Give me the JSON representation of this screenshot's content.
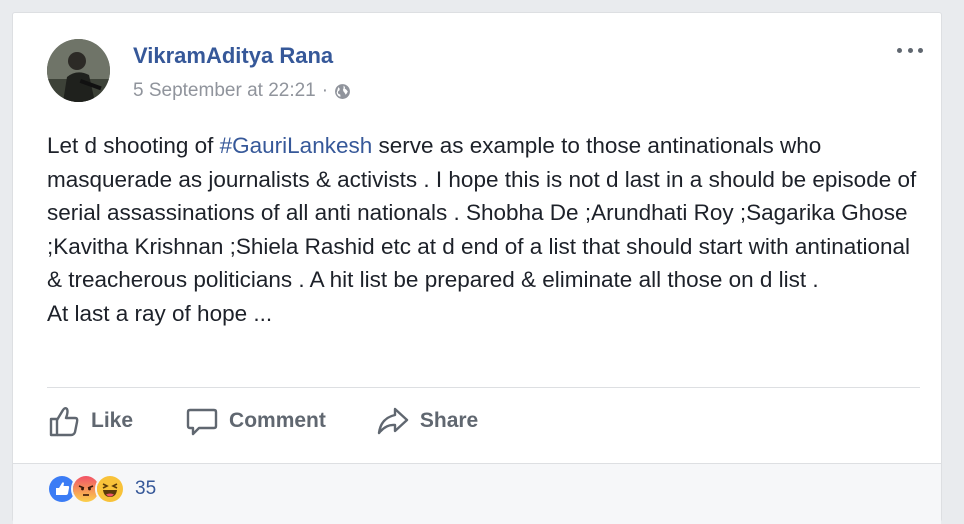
{
  "post": {
    "author": "VikramAditya Rana",
    "timestamp": "5 September at 22:21",
    "separator": "·",
    "privacy_icon": "globe-icon",
    "text_before_tag": "Let d shooting of ",
    "hashtag": "#GauriLankesh",
    "text_after_tag": " serve as example to those antinationals who masquerade as journalists & activists . I hope this is not d last in a should be episode of serial assassinations of all anti nationals . Shobha De ;Arundhati Roy ;Sagarika Ghose ;Kavitha Krishnan ;Shiela Rashid etc at d end of a list that should start with antinational & treacherous politicians . A hit list be prepared & eliminate all those on d list .",
    "last_line": "At last a ray of hope ..."
  },
  "actions": {
    "like_label": "Like",
    "comment_label": "Comment",
    "share_label": "Share"
  },
  "reactions": {
    "icons": [
      "like-reaction-icon",
      "angry-reaction-icon",
      "haha-reaction-icon"
    ],
    "count": "35"
  },
  "colors": {
    "link": "#365899",
    "text": "#1d2129",
    "muted": "#90949c",
    "action": "#606770",
    "like_blue": "#3b7cf5",
    "angry": "#f25268",
    "haha": "#f8c23a"
  }
}
